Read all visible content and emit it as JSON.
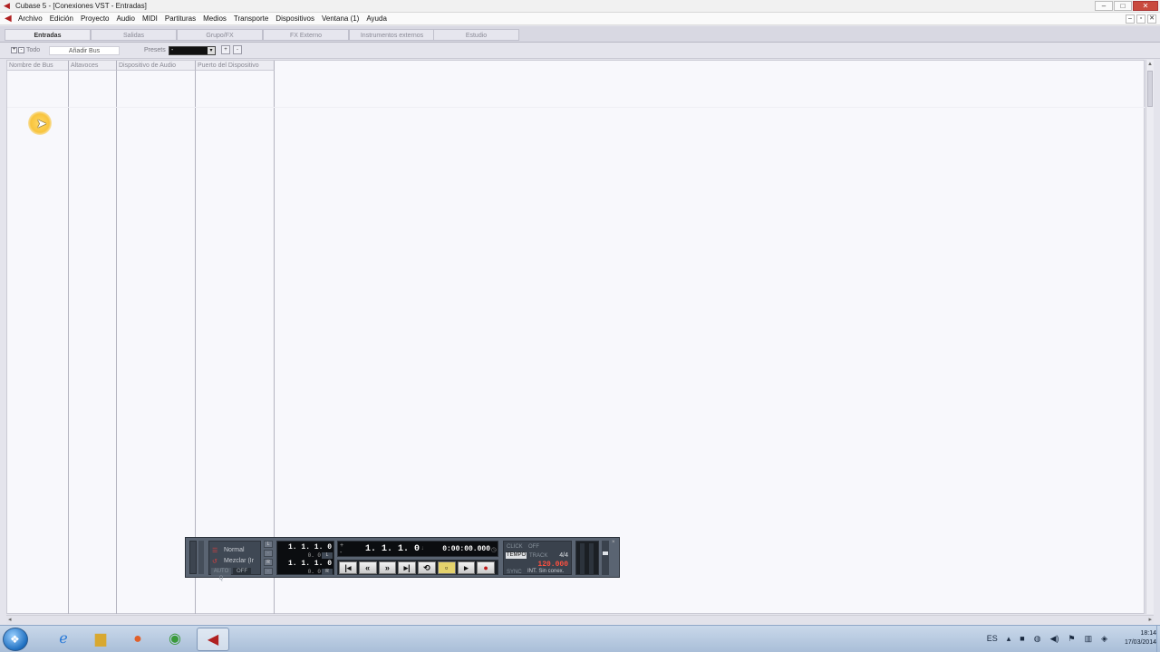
{
  "window": {
    "title": "Cubase 5 - [Conexiones VST - Entradas]",
    "controls": [
      "–",
      "□",
      "✕"
    ],
    "mdi_controls": [
      "–",
      "▫",
      "✕"
    ]
  },
  "menu": {
    "items": [
      "Archivo",
      "Edición",
      "Proyecto",
      "Audio",
      "MIDI",
      "Partituras",
      "Medios",
      "Transporte",
      "Dispositivos",
      "Ventana (1)",
      "Ayuda"
    ]
  },
  "tabs": [
    {
      "label": "Entradas",
      "active": true
    },
    {
      "label": "Salidas",
      "active": false
    },
    {
      "label": "Grupo/FX",
      "active": false
    },
    {
      "label": "FX Externo",
      "active": false
    },
    {
      "label": "Instrumentos externos",
      "active": false
    },
    {
      "label": "Estudio",
      "active": false
    }
  ],
  "toolbar": {
    "expand": "+",
    "collapse": "-",
    "all_label": "Todo",
    "add_bus_label": "Añadir Bus",
    "presets_label": "Presets",
    "presets_value": "-",
    "save_preset": "+",
    "delete_preset": "-"
  },
  "table": {
    "columns": [
      "Nombre de Bus",
      "Altavoces",
      "Dispositivo de Audio",
      "Puerto del Dispositivo"
    ]
  },
  "transport": {
    "mode_normal": "Normal",
    "mode_mix": "Mezclar (Ir",
    "auto_label": "AUTO Q",
    "auto_value": "OFF",
    "left_locator": "1. 1. 1.   0",
    "left_locator_sub": "0.   0",
    "left_tag": "L",
    "right_locator": "1. 1. 1.   0",
    "right_locator_sub": "0.   0",
    "right_tag": "R",
    "position_bars": "1. 1. 1.   0",
    "position_time": "0:00:00.000",
    "click_label": "CLICK",
    "click_value": "OFF",
    "tempo_label": "TEMPO",
    "tempo_mode": "TRACK",
    "signature": "4/4",
    "tempo_value": "120.000",
    "sync_label": "SYNC",
    "sync_value": "INT. Sin conex."
  },
  "taskbar": {
    "language": "ES",
    "time": "18:14",
    "date": "17/03/2014"
  }
}
